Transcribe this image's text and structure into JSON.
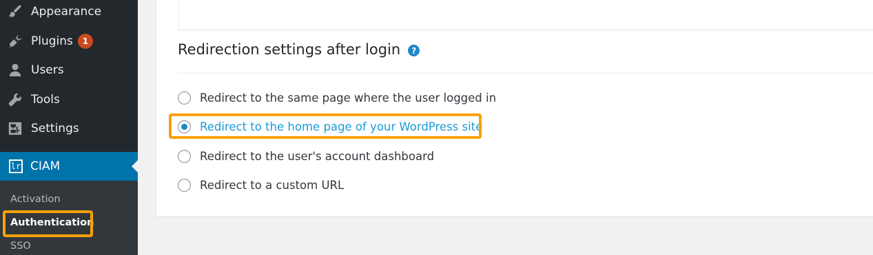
{
  "sidebar": {
    "menu": [
      {
        "label": "Appearance",
        "icon": "paintbrush-icon"
      },
      {
        "label": "Plugins",
        "icon": "plugin-icon",
        "badge": "1"
      },
      {
        "label": "Users",
        "icon": "users-icon"
      },
      {
        "label": "Tools",
        "icon": "wrench-icon"
      },
      {
        "label": "Settings",
        "icon": "settings-icon"
      }
    ],
    "active": {
      "label": "CIAM",
      "icon": "ciam-logo-icon",
      "logo_text": "lr"
    },
    "submenu": [
      {
        "label": "Activation"
      },
      {
        "label": "Authentication",
        "current": true
      },
      {
        "label": "SSO"
      }
    ]
  },
  "main": {
    "section_title": "Redirection settings after login",
    "help_icon": "?",
    "options": [
      {
        "label": "Redirect to the same page where the user logged in",
        "checked": false
      },
      {
        "label": "Redirect to the home page of your WordPress site",
        "checked": true
      },
      {
        "label": "Redirect to the user's account dashboard",
        "checked": false
      },
      {
        "label": "Redirect to a custom URL",
        "checked": false
      }
    ]
  },
  "colors": {
    "sidebar_bg": "#23282d",
    "submenu_bg": "#32373c",
    "active_bg": "#0073aa",
    "highlight": "#f7a10a",
    "link_blue": "#1a9bd7",
    "badge": "#ca4a1f"
  }
}
